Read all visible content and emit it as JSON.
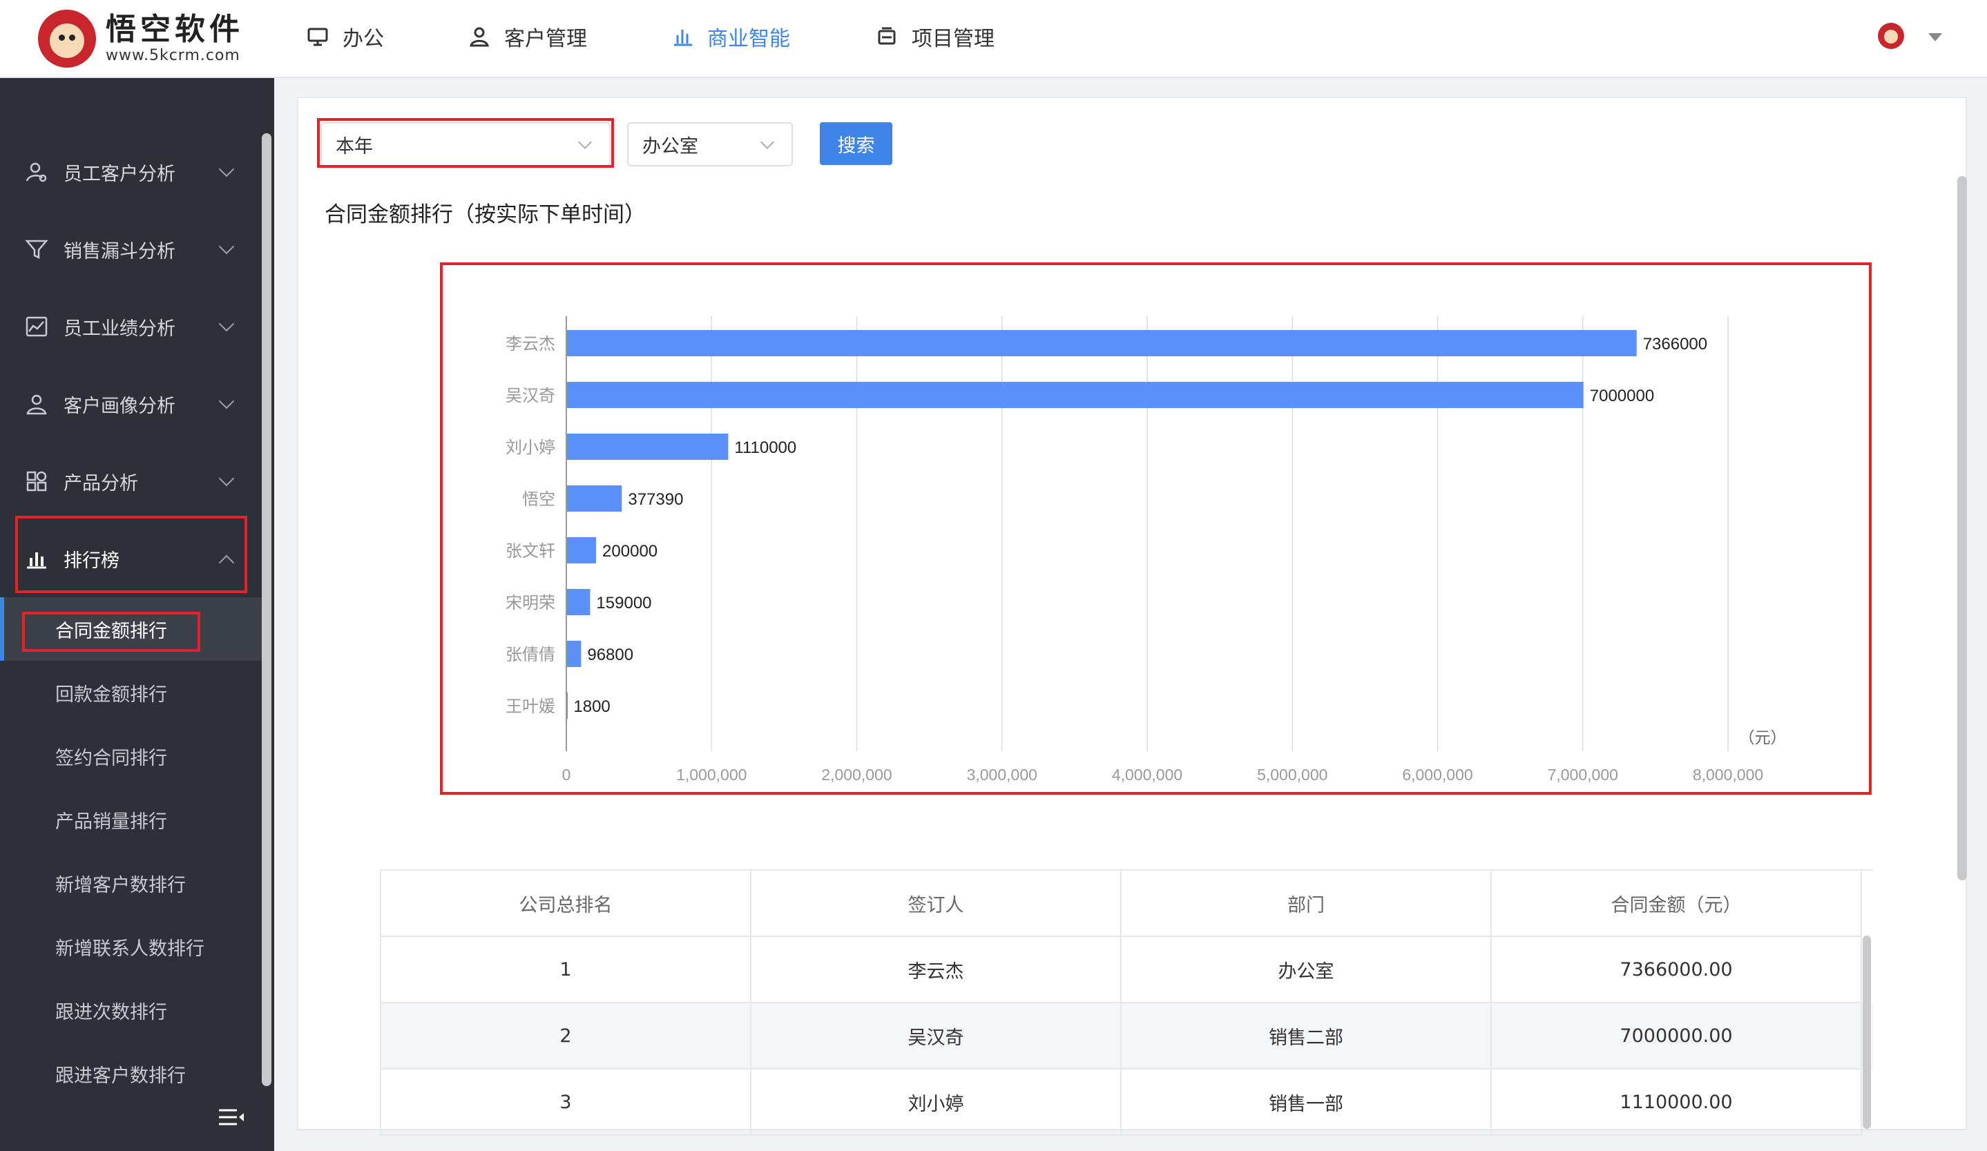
{
  "header": {
    "logo_title": "悟空软件",
    "logo_sub": "www.5kcrm.com",
    "nav": [
      {
        "label": "办公",
        "icon": "monitor-icon"
      },
      {
        "label": "客户管理",
        "icon": "user-icon"
      },
      {
        "label": "商业智能",
        "icon": "bar-chart-icon",
        "active": true
      },
      {
        "label": "项目管理",
        "icon": "printer-icon"
      }
    ]
  },
  "sidebar": {
    "menus": [
      {
        "label": "员工客户分析",
        "icon": "user-search-icon"
      },
      {
        "label": "销售漏斗分析",
        "icon": "funnel-icon"
      },
      {
        "label": "员工业绩分析",
        "icon": "line-chart-icon"
      },
      {
        "label": "客户画像分析",
        "icon": "user-icon"
      },
      {
        "label": "产品分析",
        "icon": "grid-icon"
      },
      {
        "label": "排行榜",
        "icon": "bar-chart-icon",
        "open": true
      }
    ],
    "submenu": [
      {
        "label": "合同金额排行",
        "active": true
      },
      {
        "label": "回款金额排行"
      },
      {
        "label": "签约合同排行"
      },
      {
        "label": "产品销量排行"
      },
      {
        "label": "新增客户数排行"
      },
      {
        "label": "新增联系人数排行"
      },
      {
        "label": "跟进次数排行"
      },
      {
        "label": "跟进客户数排行"
      }
    ]
  },
  "filters": {
    "period": "本年",
    "department": "办公室",
    "search_label": "搜索"
  },
  "section_title": "合同金额排行（按实际下单时间）",
  "chart_data": {
    "type": "bar",
    "orientation": "horizontal",
    "categories": [
      "李云杰",
      "吴汉奇",
      "刘小婷",
      "悟空",
      "张文轩",
      "宋明荣",
      "张倩倩",
      "王叶媛"
    ],
    "values": [
      7366000,
      7000000,
      1110000,
      377390,
      200000,
      159000,
      96800,
      1800
    ],
    "value_labels": [
      "7366000",
      "7000000",
      "1110000",
      "377390",
      "200000",
      "159000",
      "96800",
      "1800"
    ],
    "xlim": [
      0,
      8000000
    ],
    "xticks": [
      "0",
      "1,000,000",
      "2,000,000",
      "3,000,000",
      "4,000,000",
      "5,000,000",
      "6,000,000",
      "7,000,000",
      "8,000,000"
    ],
    "unit": "（元）",
    "grid": true,
    "bar_color": "#5b8ff9"
  },
  "table": {
    "headers": [
      "公司总排名",
      "签订人",
      "部门",
      "合同金额（元）"
    ],
    "rows": [
      [
        "1",
        "李云杰",
        "办公室",
        "7366000.00"
      ],
      [
        "2",
        "吴汉奇",
        "销售二部",
        "7000000.00"
      ],
      [
        "3",
        "刘小婷",
        "销售一部",
        "1110000.00"
      ]
    ]
  },
  "colors": {
    "accent": "#3e84e9",
    "sidebar_bg": "#2d3037",
    "highlight": "#e6212a"
  }
}
